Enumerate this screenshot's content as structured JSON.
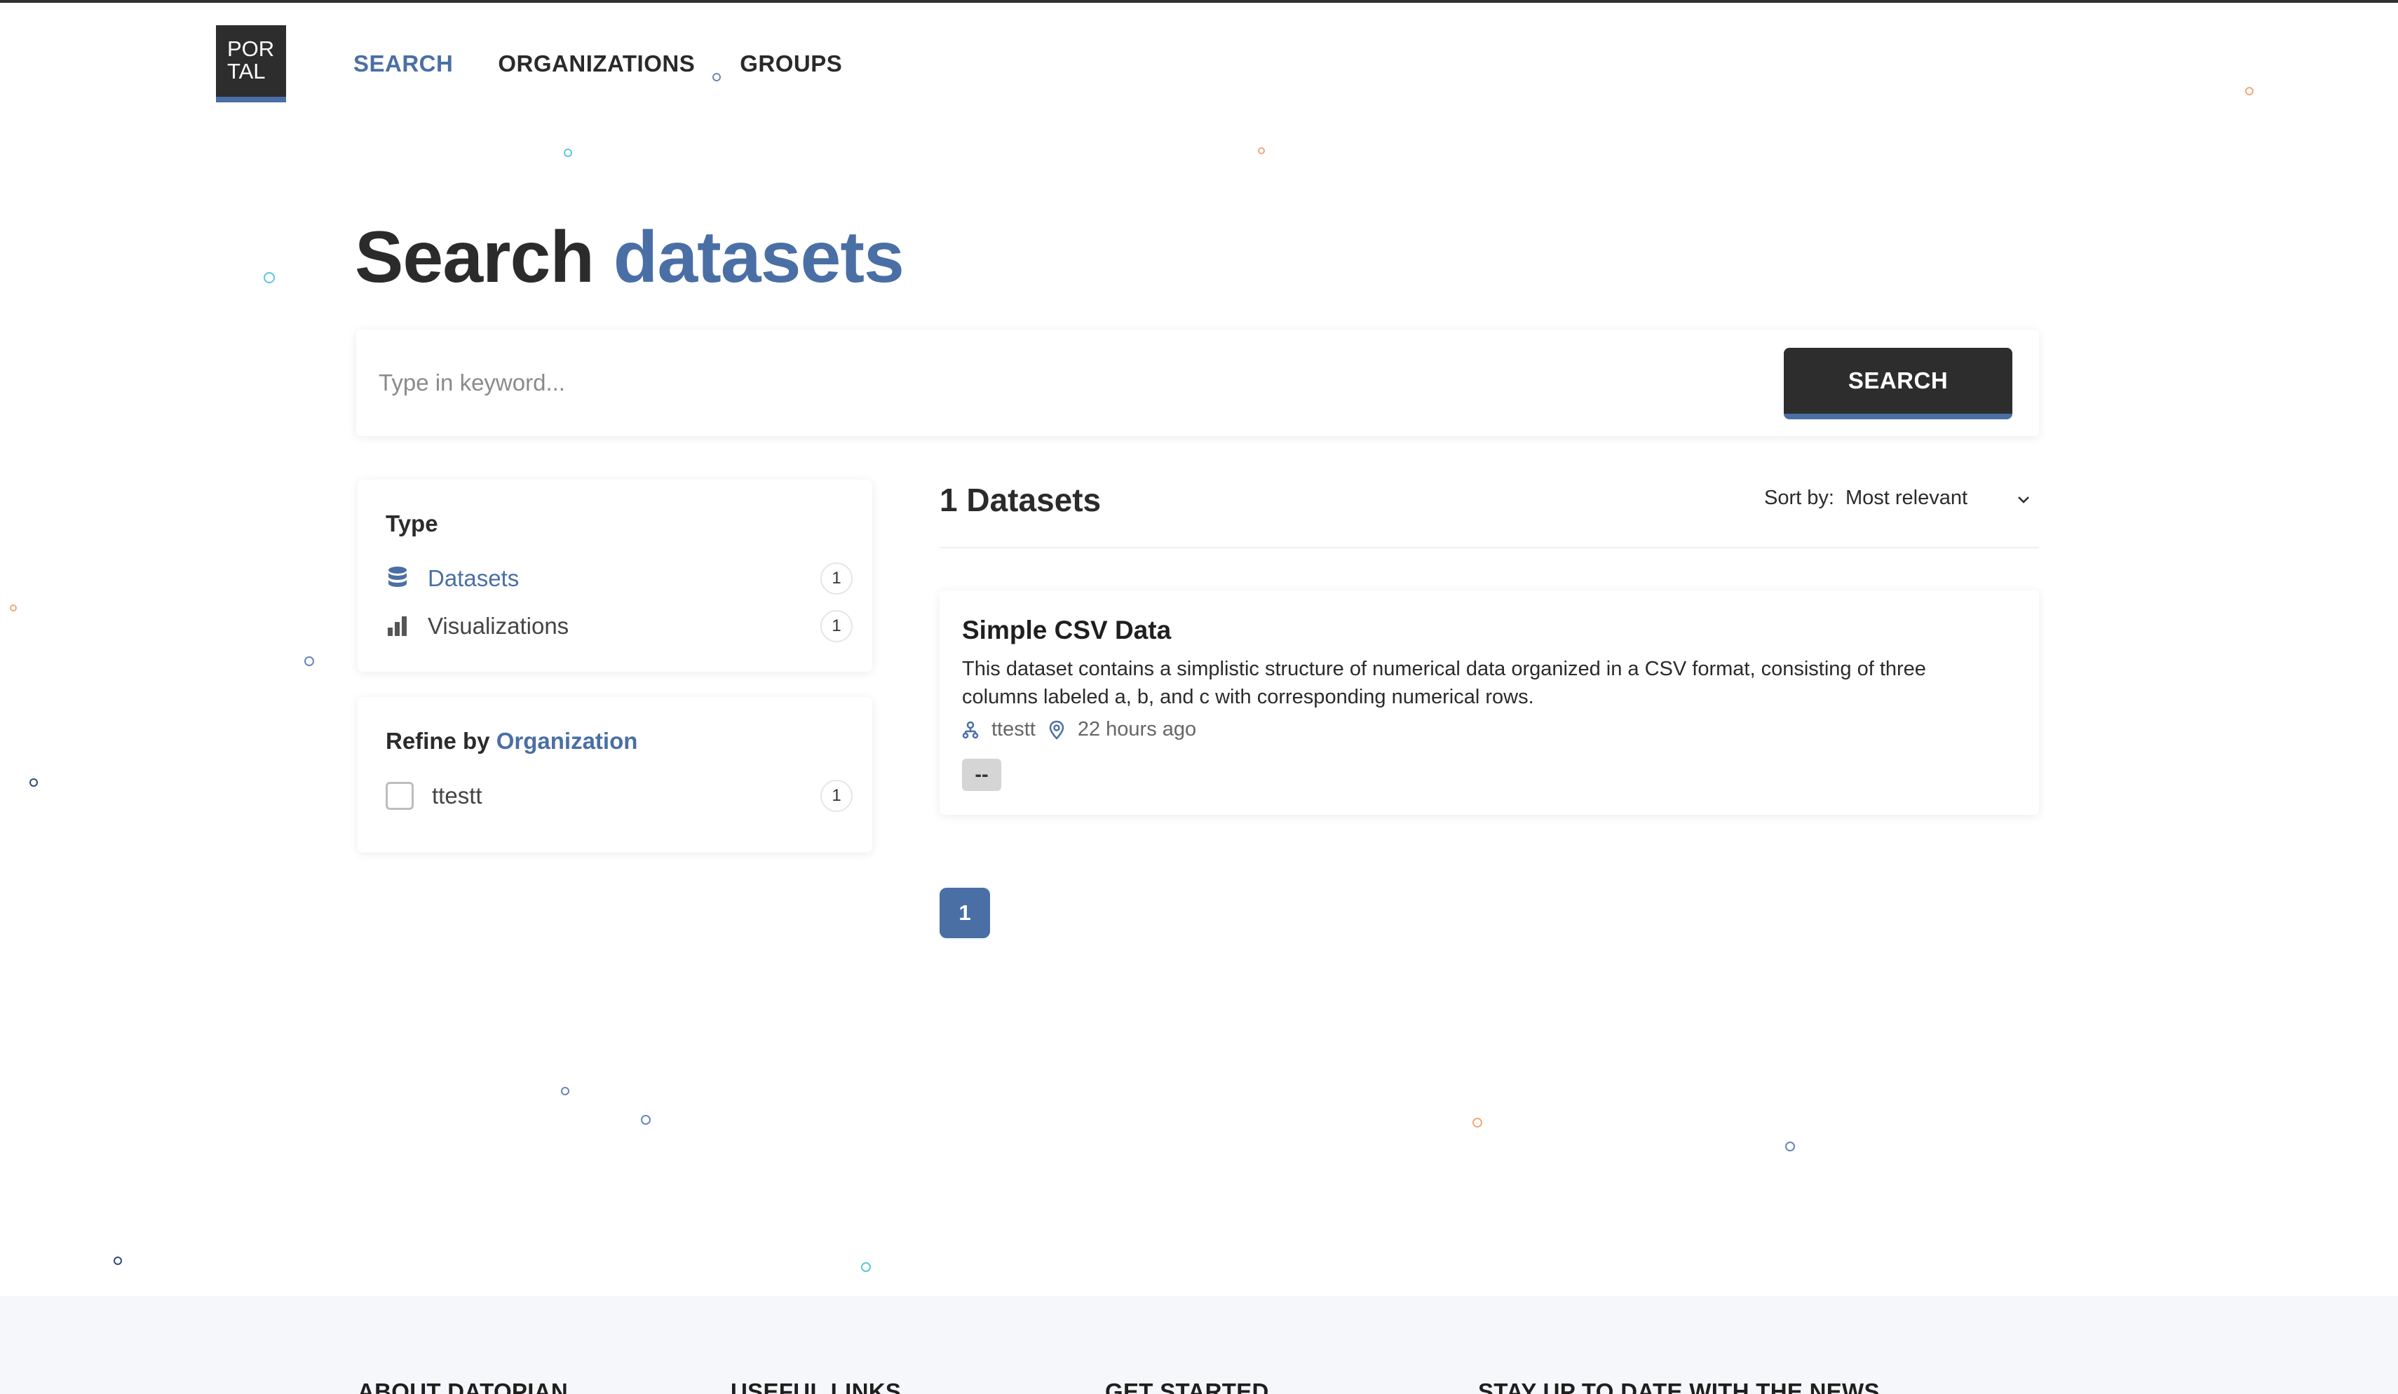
{
  "header": {
    "logo_line1": "POR",
    "logo_line2": "TAL",
    "nav": [
      {
        "label": "SEARCH",
        "active": true
      },
      {
        "label": "ORGANIZATIONS",
        "active": false
      },
      {
        "label": "GROUPS",
        "active": false
      }
    ]
  },
  "page": {
    "title_main": "Search",
    "title_accent": "datasets"
  },
  "search": {
    "placeholder": "Type in keyword...",
    "button_label": "SEARCH"
  },
  "filters": {
    "type_title": "Type",
    "type_items": [
      {
        "label": "Datasets",
        "count": "1",
        "icon": "database-icon"
      },
      {
        "label": "Visualizations",
        "count": "1",
        "icon": "bar-chart-icon"
      }
    ],
    "refine_prefix": "Refine by",
    "refine_accent": "Organization",
    "org_items": [
      {
        "label": "ttestt",
        "count": "1"
      }
    ]
  },
  "results": {
    "count_label": "1 Datasets",
    "sort_label": "Sort by:",
    "sort_value": "Most relevant",
    "items": [
      {
        "title": "Simple CSV Data",
        "description": "This dataset contains a simplistic structure of numerical data organized in a CSV format, consisting of three columns labeled a, b, and c with corresponding numerical rows.",
        "organization": "ttestt",
        "time": "22 hours ago",
        "tag": "--"
      }
    ]
  },
  "pagination": {
    "current": "1"
  },
  "footer": {
    "columns": [
      "ABOUT DATOPIAN",
      "USEFUL LINKS",
      "GET STARTED",
      "STAY UP TO DATE WITH THE NEWS"
    ]
  },
  "colors": {
    "accent": "#4a6fa5",
    "dark": "#2d2d2d",
    "dot_cyan": "#5bc8d8",
    "dot_orange": "#f0a878",
    "dot_blue": "#6b85b8",
    "dot_navy": "#2f4a7a"
  }
}
